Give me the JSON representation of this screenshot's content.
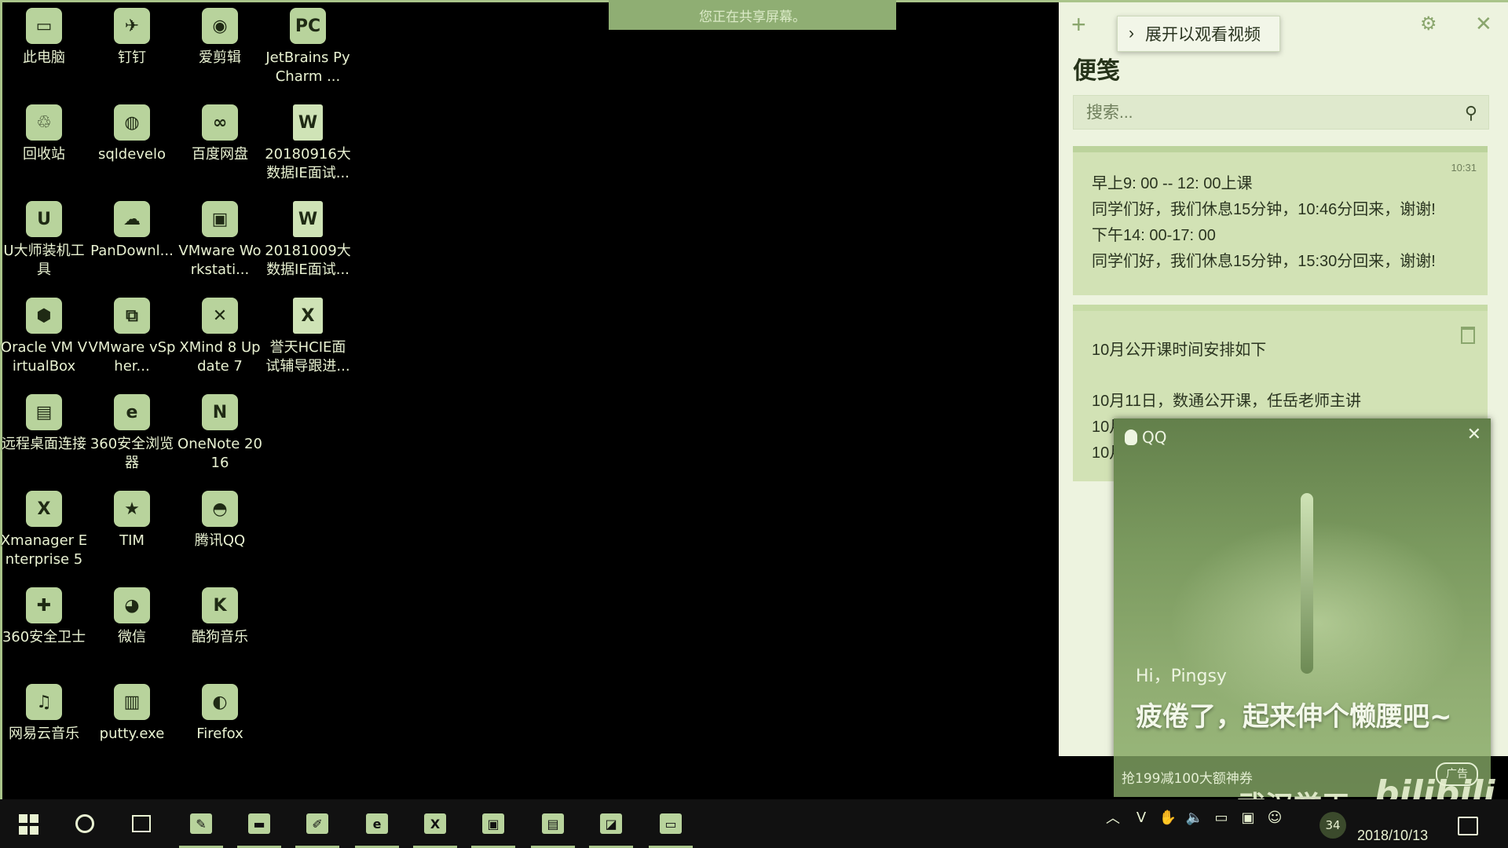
{
  "share_banner": "您正在共享屏幕。",
  "desktop_icons": [
    {
      "label": "此电脑",
      "glyph": "▭"
    },
    {
      "label": "钉钉",
      "glyph": "✈"
    },
    {
      "label": "爱剪辑",
      "glyph": "◉"
    },
    {
      "label": "JetBrains PyCharm ...",
      "glyph": "PC"
    },
    {
      "label": "回收站",
      "glyph": "♲"
    },
    {
      "label": "sqldevelo",
      "glyph": "◍"
    },
    {
      "label": "百度网盘",
      "glyph": "∞"
    },
    {
      "label": "20180916大数据IE面试...",
      "glyph": "W"
    },
    {
      "label": "U大师装机工具",
      "glyph": "U"
    },
    {
      "label": "PanDownl...",
      "glyph": "☁"
    },
    {
      "label": "VMware Workstati...",
      "glyph": "▣"
    },
    {
      "label": "20181009大数据IE面试...",
      "glyph": "W"
    },
    {
      "label": "Oracle VM VirtualBox",
      "glyph": "⬢"
    },
    {
      "label": "VMware vSpher...",
      "glyph": "⧉"
    },
    {
      "label": "XMind 8 Update 7",
      "glyph": "✕"
    },
    {
      "label": "誉天HCIE面试辅导跟进...",
      "glyph": "X"
    },
    {
      "label": "远程桌面连接",
      "glyph": "▤"
    },
    {
      "label": "360安全浏览器",
      "glyph": "e"
    },
    {
      "label": "OneNote 2016",
      "glyph": "N"
    },
    {
      "label": "Xmanager Enterprise 5",
      "glyph": "X"
    },
    {
      "label": "TIM",
      "glyph": "★"
    },
    {
      "label": "腾讯QQ",
      "glyph": "◓"
    },
    {
      "label": "360安全卫士",
      "glyph": "✚"
    },
    {
      "label": "微信",
      "glyph": "◕"
    },
    {
      "label": "酷狗音乐",
      "glyph": "K"
    },
    {
      "label": "网易云音乐",
      "glyph": "♫"
    },
    {
      "label": "putty.exe",
      "glyph": "▥"
    },
    {
      "label": "Firefox",
      "glyph": "◐"
    }
  ],
  "sticky_notes": {
    "tooltip": "展开以观看视频",
    "tooltip_icon": "chevron-right-icon",
    "title": "便笺",
    "search_placeholder": "搜索...",
    "notes": [
      {
        "time": "10:31",
        "lines": [
          "早上9: 00 -- 12: 00上课",
          "同学们好，我们休息15分钟，10:46分回来，谢谢!",
          "下午14: 00-17: 00",
          "同学们好，我们休息15分钟，15:30分回来，谢谢!"
        ]
      },
      {
        "lines": [
          "10月公开课时间安排如下",
          "10月11日，数通公开课，任岳老师主讲",
          "10月",
          "10月"
        ]
      }
    ]
  },
  "qq_popup": {
    "app": "QQ",
    "greeting": "Hi，Pingsy",
    "message": "疲倦了，起来伸个懒腰吧~",
    "ad_text": "抢199减100大额神券",
    "ad_tag": "广告"
  },
  "watermark": "武汉誉天",
  "watermark_logo": "bilibili",
  "taskbar": {
    "badge_count": "34",
    "clock_date": "2018/10/13"
  },
  "colors": {
    "tint": "#a9c48a",
    "note_bg": "#d2e2b5",
    "panel_bg": "#edf3df"
  }
}
